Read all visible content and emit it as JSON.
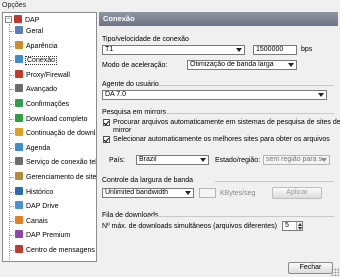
{
  "window": {
    "title": "Opções"
  },
  "sidebar": {
    "root": {
      "label": "DAP",
      "icon": "dap-app-icon",
      "color": "#c0392b"
    },
    "items": [
      {
        "label": "Geral",
        "icon": "general-icon",
        "color": "#5a7fb5"
      },
      {
        "label": "Aparência",
        "icon": "appearance-icon",
        "color": "#d08a2a"
      },
      {
        "label": "Conexão",
        "icon": "connection-icon",
        "color": "#3a8fd0",
        "selected": true
      },
      {
        "label": "Proxy/Firewall",
        "icon": "firewall-icon",
        "color": "#c0392b"
      },
      {
        "label": "Avançado",
        "icon": "advanced-icon",
        "color": "#6c6c6c"
      },
      {
        "label": "Confirmações",
        "icon": "confirmations-icon",
        "color": "#2ea043"
      },
      {
        "label": "Download completo",
        "icon": "download-complete-icon",
        "color": "#2ea043"
      },
      {
        "label": "Continuação de downl",
        "icon": "resume-icon",
        "color": "#e0a020"
      },
      {
        "label": "Agenda",
        "icon": "schedule-icon",
        "color": "#3a8fd0"
      },
      {
        "label": "Serviço de conexão tel",
        "icon": "dialup-icon",
        "color": "#6c6c6c"
      },
      {
        "label": "Gerenciamento de sites",
        "icon": "sites-icon",
        "color": "#b58b3a"
      },
      {
        "label": "Histórico",
        "icon": "history-icon",
        "color": "#2b6cb0"
      },
      {
        "label": "DAP Drive",
        "icon": "dap-drive-icon",
        "color": "#4a90d9"
      },
      {
        "label": "Canais",
        "icon": "channels-icon",
        "color": "#e67e22"
      },
      {
        "label": "DAP Premium",
        "icon": "premium-icon",
        "color": "#8e44ad"
      },
      {
        "label": "Centro de mensagens",
        "icon": "message-center-icon",
        "color": "#c0392b"
      }
    ]
  },
  "pane": {
    "header": "Conexão",
    "speed": {
      "label": "Tipo/velocidade de conexão",
      "type_value": "T1",
      "bps_value": "1500000",
      "bps_unit": "bps"
    },
    "accel": {
      "label": "Modo de aceleração:",
      "value": "Otimização de banda larga"
    },
    "agent": {
      "label": "Agente do usuário",
      "value": "DA 7.0"
    },
    "mirrors": {
      "label": "Pesquisa em mirrors",
      "check1_line1": "Procurar arquivos automaticamente em sistemas de pesquisa de sites de",
      "check1_line2": "mirror",
      "check1_checked": true,
      "check2": "Selecionar automaticamente os melhores sites para obter os arquivos",
      "check2_checked": true,
      "country_label": "País:",
      "country_value": "Brazil",
      "region_label": "Estado/região:",
      "region_value": "sem região para s"
    },
    "bandwidth": {
      "label": "Controle da largura de banda",
      "value": "Unlimited bandwidth",
      "kbytes_value": "",
      "unit": "KBytes/seg",
      "apply_label": "Aplicar"
    },
    "queue": {
      "label": "Fila de downloads",
      "max_label": "Nº máx. de downloads simultâneos (arquivos diferentes)",
      "max_value": "5"
    }
  },
  "footer": {
    "close_label": "Fechar"
  }
}
